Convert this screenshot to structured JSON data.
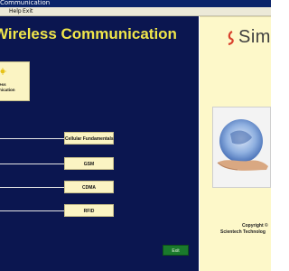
{
  "window": {
    "title": "Communication"
  },
  "menu": {
    "items": [
      "Help",
      "Exit"
    ]
  },
  "main": {
    "heading": "Wireless Communication",
    "module": {
      "label_line1": "ess",
      "label_line2": "nication"
    },
    "buttons": [
      {
        "label": "Cellular Fundamentals"
      },
      {
        "label": "GSM"
      },
      {
        "label": "CDMA"
      },
      {
        "label": "RFID"
      }
    ],
    "exit_label": "Exit"
  },
  "side": {
    "brand_text": "Sim",
    "copyright": "Copyright ©",
    "company": "Scientech Technolog"
  },
  "colors": {
    "panel_bg": "#0b1650",
    "heading": "#f0e64a",
    "side_bg": "#fdf8c9",
    "button_bg": "#fbf4c3",
    "exit_bg": "#1a7a2c",
    "titlebar": "#0a246a"
  }
}
